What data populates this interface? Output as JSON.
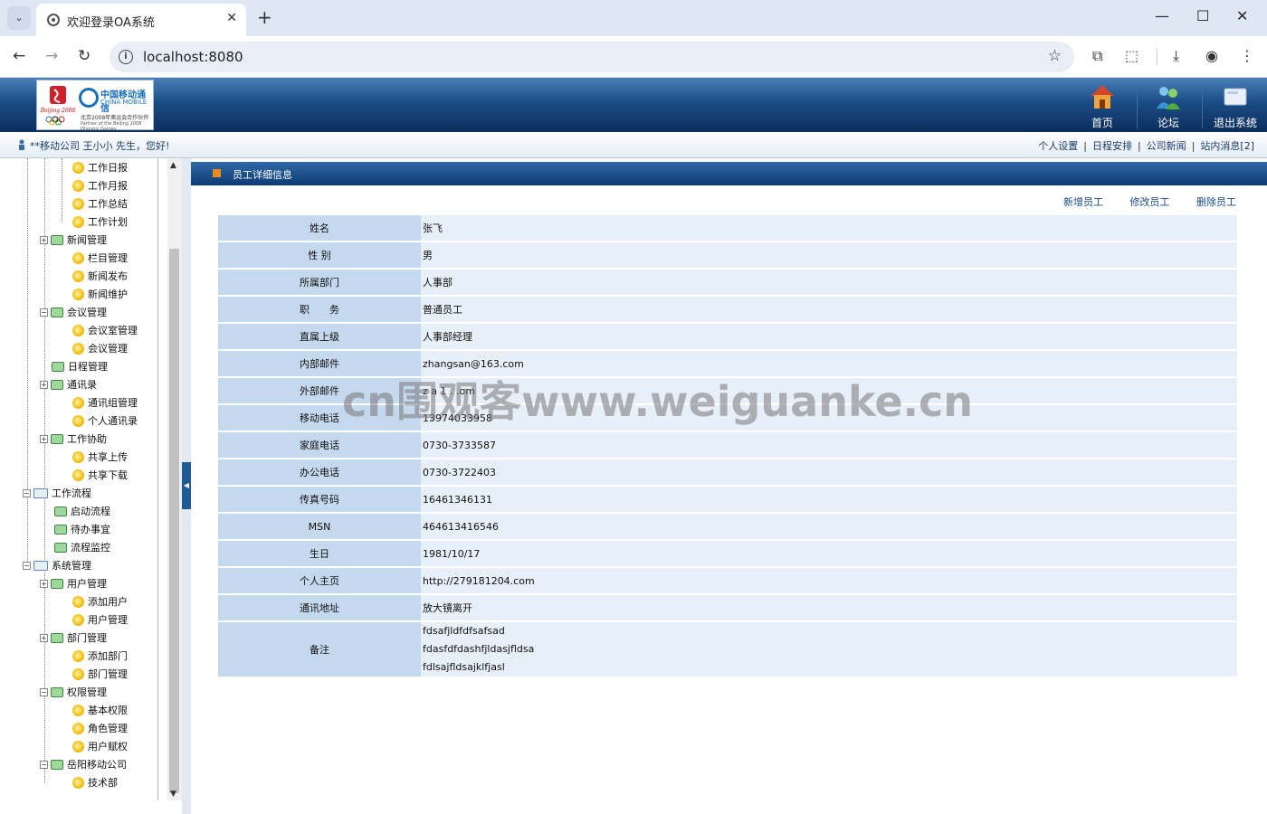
{
  "browser": {
    "tab_title": "欢迎登录OA系统",
    "url": "localhost:8080"
  },
  "header": {
    "logo": {
      "cn": "中国移动通信",
      "en": "CHINA MOBILE",
      "sub1": "北京2008年奥运会合作伙伴",
      "sub2": "Partner of the Beijing 2008 Olympic Games"
    },
    "nav": [
      {
        "label": "首页",
        "icon": "home-icon"
      },
      {
        "label": "论坛",
        "icon": "forum-icon"
      },
      {
        "label": "退出系统",
        "icon": "exit-icon"
      }
    ]
  },
  "userbar": {
    "greeting": "**移动公司 王小小 先生，您好!",
    "links": [
      "个人设置",
      "日程安排",
      "公司新闻",
      "站内消息[2]"
    ]
  },
  "sidebar": {
    "items": [
      {
        "label": "工作日报",
        "type": "leaf"
      },
      {
        "label": "工作月报",
        "type": "leaf"
      },
      {
        "label": "工作总结",
        "type": "leaf"
      },
      {
        "label": "工作计划",
        "type": "leaf"
      },
      {
        "label": "新闻管理",
        "type": "module"
      },
      {
        "label": "栏目管理",
        "type": "leaf"
      },
      {
        "label": "新闻发布",
        "type": "leaf"
      },
      {
        "label": "新闻维护",
        "type": "leaf"
      },
      {
        "label": "会议管理",
        "type": "module"
      },
      {
        "label": "会议室管理",
        "type": "leaf"
      },
      {
        "label": "会议管理",
        "type": "leaf"
      },
      {
        "label": "日程管理",
        "type": "module"
      },
      {
        "label": "通讯录",
        "type": "module"
      },
      {
        "label": "通讯组管理",
        "type": "leaf"
      },
      {
        "label": "个人通讯录",
        "type": "leaf"
      },
      {
        "label": "工作协助",
        "type": "module"
      },
      {
        "label": "共享上传",
        "type": "leaf"
      },
      {
        "label": "共享下载",
        "type": "leaf"
      },
      {
        "label": "工作流程",
        "type": "folder"
      },
      {
        "label": "启动流程",
        "type": "module"
      },
      {
        "label": "待办事宜",
        "type": "module"
      },
      {
        "label": "流程监控",
        "type": "module"
      },
      {
        "label": "系统管理",
        "type": "folder"
      },
      {
        "label": "用户管理",
        "type": "module"
      },
      {
        "label": "添加用户",
        "type": "leaf"
      },
      {
        "label": "用户管理",
        "type": "leaf"
      },
      {
        "label": "部门管理",
        "type": "module"
      },
      {
        "label": "添加部门",
        "type": "leaf"
      },
      {
        "label": "部门管理",
        "type": "leaf"
      },
      {
        "label": "权限管理",
        "type": "module"
      },
      {
        "label": "基本权限",
        "type": "leaf"
      },
      {
        "label": "角色管理",
        "type": "leaf"
      },
      {
        "label": "用户赋权",
        "type": "leaf"
      },
      {
        "label": "岳阳移动公司",
        "type": "module"
      },
      {
        "label": "技术部",
        "type": "leaf"
      }
    ]
  },
  "panel": {
    "title": "员工详细信息",
    "actions": [
      "新增员工",
      "修改员工",
      "删除员工"
    ]
  },
  "employee": {
    "rows": [
      {
        "key": "姓名",
        "value": "张飞"
      },
      {
        "key": "性 别",
        "value": "男"
      },
      {
        "key": "所属部门",
        "value": "人事部"
      },
      {
        "key": "职　　务",
        "value": "普通员工"
      },
      {
        "key": "直属上级",
        "value": "人事部经理"
      },
      {
        "key": "内部邮件",
        "value": "zhangsan@163.com"
      },
      {
        "key": "外部邮件",
        "value": "z     a   1   .   .om"
      },
      {
        "key": "移动电话",
        "value": "13974033958"
      },
      {
        "key": "家庭电话",
        "value": "0730-3733587"
      },
      {
        "key": "办公电话",
        "value": "0730-3722403"
      },
      {
        "key": "传真号码",
        "value": "16461346131"
      },
      {
        "key": "MSN",
        "value": "464613416546"
      },
      {
        "key": "生日",
        "value": "1981/10/17"
      },
      {
        "key": "个人主页",
        "value": "http://279181204.com"
      },
      {
        "key": "通讯地址",
        "value": "放大镜离开"
      }
    ],
    "note": {
      "key": "备注",
      "lines": [
        "fdsafjldfdfsafsad",
        "fdasfdfdashfjldasjfldsa",
        "fdlsajfldsajklfjasl"
      ]
    }
  },
  "watermark": "cn围观客www.weiguanke.cn"
}
